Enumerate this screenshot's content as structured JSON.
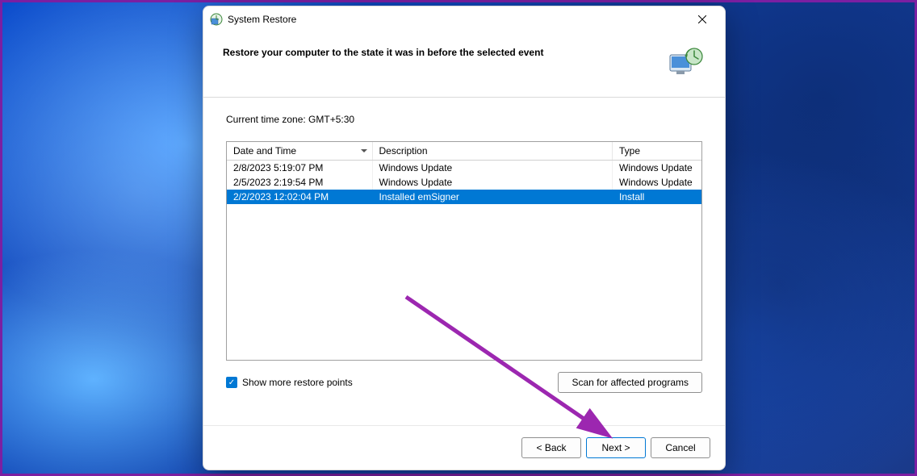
{
  "titlebar": {
    "title": "System Restore"
  },
  "header": {
    "title": "Restore your computer to the state it was in before the selected event"
  },
  "content": {
    "timezone_label": "Current time zone: GMT+5:30",
    "table": {
      "columns": {
        "date": "Date and Time",
        "description": "Description",
        "type": "Type"
      },
      "rows": [
        {
          "date": "2/8/2023 5:19:07 PM",
          "description": "Windows Update",
          "type": "Windows Update",
          "selected": false
        },
        {
          "date": "2/5/2023 2:19:54 PM",
          "description": "Windows Update",
          "type": "Windows Update",
          "selected": false
        },
        {
          "date": "2/2/2023 12:02:04 PM",
          "description": "Installed emSigner",
          "type": "Install",
          "selected": true
        }
      ]
    },
    "show_more_label": "Show more restore points",
    "scan_button_label": "Scan for affected programs"
  },
  "footer": {
    "back_label": "< Back",
    "next_label": "Next >",
    "cancel_label": "Cancel"
  }
}
